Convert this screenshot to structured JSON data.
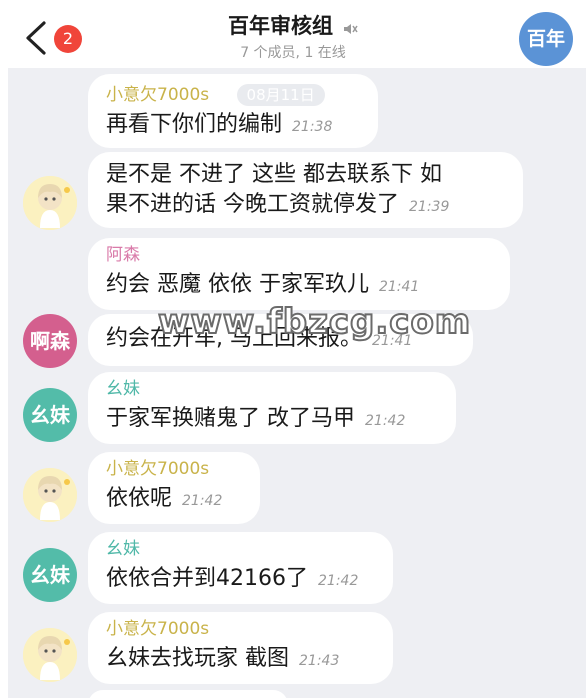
{
  "header": {
    "title": "百年审核组",
    "subtitle": "7 个成员, 1 在线",
    "unread_badge": "2",
    "group_avatar_text": "百年"
  },
  "messages": [
    {
      "sender": "小意欠7000s",
      "sender_color": "#c9b34a",
      "avatar": "anime",
      "date": "08月11日",
      "lines": [
        "再看下你们的编制"
      ],
      "time": "21:38"
    },
    {
      "sender": "",
      "avatar": "anime",
      "lines": [
        "是不是 不进了 这些 都去联系下 如",
        "果不进的话 今晚工资就停发了"
      ],
      "time": "21:39"
    },
    {
      "sender": "阿森",
      "sender_color": "#d97aa9",
      "avatar": "none",
      "lines": [
        "约会 恶魔  依依  于家军玖儿"
      ],
      "time": "21:41"
    },
    {
      "sender": "",
      "avatar": "text",
      "avatar_text": "啊森",
      "avatar_color": "#d45f8e",
      "lines": [
        "约会在开车, 马上回来报。"
      ],
      "time": "21:41"
    },
    {
      "sender": "幺妹",
      "sender_color": "#4fb8a8",
      "avatar": "text",
      "avatar_text": "幺妹",
      "avatar_color": "#53bca9",
      "lines": [
        "于家军换赌鬼了 改了马甲"
      ],
      "time": "21:42"
    },
    {
      "sender": "小意欠7000s",
      "sender_color": "#c9b34a",
      "avatar": "anime",
      "lines": [
        "依依呢"
      ],
      "time": "21:42"
    },
    {
      "sender": "幺妹",
      "sender_color": "#4fb8a8",
      "avatar": "text",
      "avatar_text": "幺妹",
      "avatar_color": "#53bca9",
      "lines": [
        "依依合并到42166了"
      ],
      "time": "21:42"
    },
    {
      "sender": "小意欠7000s",
      "sender_color": "#c9b34a",
      "avatar": "anime",
      "lines": [
        "幺妹去找玩家  截图"
      ],
      "time": "21:43"
    }
  ],
  "watermark": "www.fbzcg.com",
  "colors": {
    "badge": "#f0453a",
    "group_avatar": "#5b93d6",
    "chat_bg": "#eeeff3"
  },
  "icons": [
    "back-chevron-icon",
    "mute-icon"
  ]
}
